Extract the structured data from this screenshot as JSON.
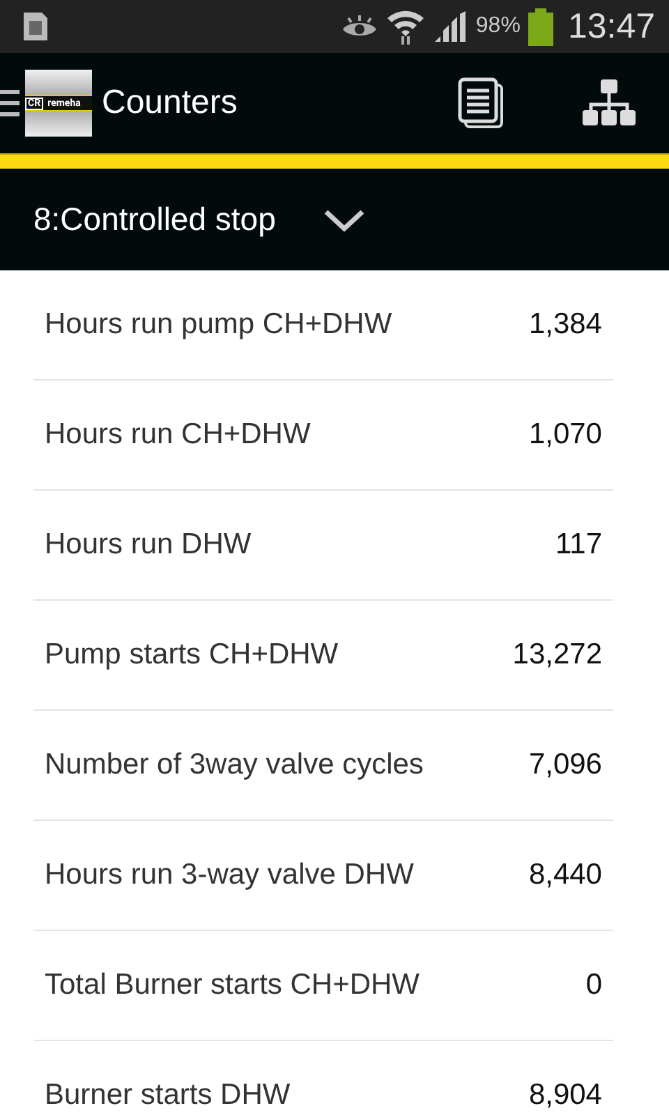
{
  "status_bar": {
    "battery": "98%",
    "time": "13:47"
  },
  "action_bar": {
    "logo": {
      "mark": "CR",
      "word": "remeha"
    },
    "title": "Counters"
  },
  "dropdown": {
    "value": "8:Controlled stop"
  },
  "counters": [
    {
      "label": "Hours run pump CH+DHW",
      "value": "1,384"
    },
    {
      "label": "Hours run CH+DHW",
      "value": "1,070"
    },
    {
      "label": "Hours run DHW",
      "value": "117"
    },
    {
      "label": "Pump starts CH+DHW",
      "value": "13,272"
    },
    {
      "label": "Number of 3way valve cycles",
      "value": "7,096"
    },
    {
      "label": "Hours run 3-way valve DHW",
      "value": "8,440"
    },
    {
      "label": "Total Burner starts CH+DHW",
      "value": "0"
    },
    {
      "label": "Burner starts DHW",
      "value": "8,904"
    }
  ]
}
